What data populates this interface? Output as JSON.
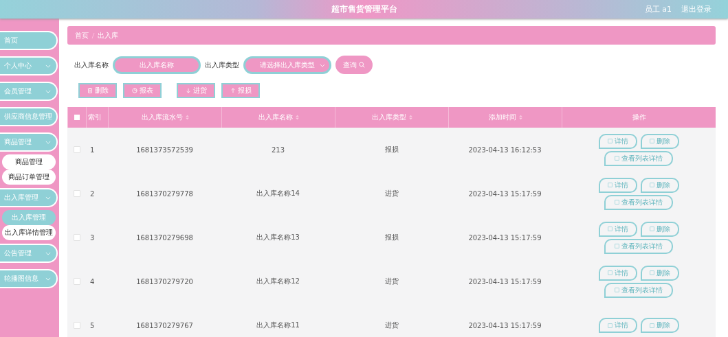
{
  "header": {
    "title": "超市售货管理平台",
    "user": "员工 a1",
    "logout": "退出登录"
  },
  "sidebar": {
    "items": [
      {
        "label": "首页",
        "expandable": false
      },
      {
        "label": "个人中心",
        "expandable": true
      },
      {
        "label": "会员管理",
        "expandable": true
      },
      {
        "label": "供应商信息管理",
        "expandable": false
      },
      {
        "label": "商品管理",
        "expandable": true,
        "children": [
          {
            "label": "商品管理",
            "selected": false
          },
          {
            "label": "商品订单管理",
            "selected": false
          }
        ]
      },
      {
        "label": "出入库管理",
        "expandable": true,
        "children": [
          {
            "label": "出入库管理",
            "selected": true
          },
          {
            "label": "出入库详情管理",
            "selected": false
          }
        ]
      },
      {
        "label": "公告管理",
        "expandable": true
      },
      {
        "label": "轮播图信息",
        "expandable": true
      }
    ]
  },
  "breadcrumb": [
    "首页",
    "出入库"
  ],
  "search": {
    "fields": [
      {
        "label": "出入库名称",
        "placeholder": "出入库名称",
        "kind": "input"
      },
      {
        "label": "出入库类型",
        "placeholder": "请选择出入库类型",
        "kind": "select"
      }
    ],
    "button": "查询"
  },
  "toolbar": [
    {
      "label": "删除",
      "kind": "delete"
    },
    {
      "label": "报表",
      "kind": "chart"
    },
    {
      "label": "进货",
      "kind": "down"
    },
    {
      "label": "报损",
      "kind": "up"
    }
  ],
  "table": {
    "all_checked": false,
    "columns": [
      {
        "label": "索引",
        "sortable": false
      },
      {
        "label": "出入库流水号",
        "sortable": true
      },
      {
        "label": "出入库名称",
        "sortable": true
      },
      {
        "label": "出入库类型",
        "sortable": true
      },
      {
        "label": "添加时间",
        "sortable": true
      },
      {
        "label": "操作",
        "sortable": false
      }
    ],
    "rows": [
      {
        "checked": false,
        "index": "1",
        "serial": "1681373572539",
        "name": "213",
        "type": "报损",
        "time": "2023-04-13 16:12:53",
        "actions": [
          "详情",
          "删除",
          "查看列表详情"
        ]
      },
      {
        "checked": false,
        "index": "2",
        "serial": "1681370279778",
        "name": "出入库名称14",
        "type": "进货",
        "time": "2023-04-13 15:17:59",
        "actions": [
          "详情",
          "删除",
          "查看列表详情"
        ]
      },
      {
        "checked": false,
        "index": "3",
        "serial": "1681370279698",
        "name": "出入库名称13",
        "type": "报损",
        "time": "2023-04-13 15:17:59",
        "actions": [
          "详情",
          "删除",
          "查看列表详情"
        ]
      },
      {
        "checked": false,
        "index": "4",
        "serial": "1681370279720",
        "name": "出入库名称12",
        "type": "进货",
        "time": "2023-04-13 15:17:59",
        "actions": [
          "详情",
          "删除",
          "查看列表详情"
        ]
      },
      {
        "checked": false,
        "index": "5",
        "serial": "1681370279767",
        "name": "出入库名称11",
        "type": "进货",
        "time": "2023-04-13 15:17:59",
        "actions": [
          "详情",
          "删除"
        ]
      }
    ]
  }
}
